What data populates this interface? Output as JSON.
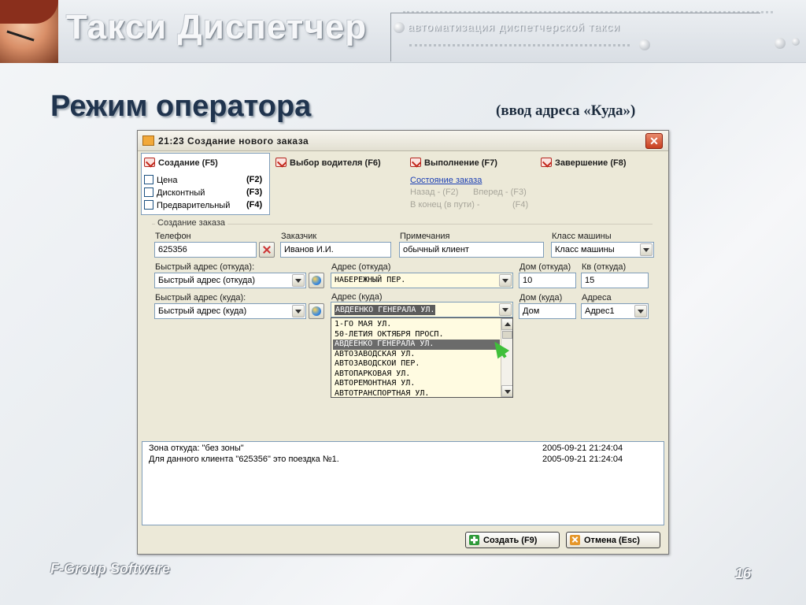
{
  "slide": {
    "app_title": "Такси Диспетчер",
    "tagline": "автоматизация диспетчерской такси",
    "title": "Режим оператора",
    "subtitle": "(ввод адреса «Куда»)",
    "footer_left": "F-Group Software",
    "page_number": "16"
  },
  "window": {
    "title": "21:23 Создание нового заказа",
    "close_label": "✕",
    "steps": [
      {
        "label": "Создание (F5)"
      },
      {
        "label": "Выбор водителя (F6)"
      },
      {
        "label": "Выполнение (F7)"
      },
      {
        "label": "Завершение (F8)"
      }
    ],
    "options": [
      {
        "label": "Цена",
        "key": "(F2)",
        "checked": false
      },
      {
        "label": "Дисконтный",
        "key": "(F3)",
        "checked": false
      },
      {
        "label": "Предварительный",
        "key": "(F4)",
        "checked": false
      }
    ],
    "order_state_link": "Состояние заказа",
    "nav": {
      "back": "Назад - (F2)",
      "forward": "Вперед - (F3)",
      "to_end": "В конец (в пути) -",
      "to_end_key": "(F4)"
    },
    "group_label": "Создание заказа",
    "form": {
      "phone_label": "Телефон",
      "phone_value": "625356",
      "customer_label": "Заказчик",
      "customer_value": "Иванов И.И.",
      "notes_label": "Примечания",
      "notes_value": "обычный клиент",
      "car_class_label": "Класс машины",
      "car_class_value": "Класс машины",
      "quick_from_label": "Быстрый адрес (откуда):",
      "quick_from_value": "Быстрый адрес (откуда)",
      "addr_from_label": "Адрес (откуда)",
      "addr_from_value": "НАБЕРЕЖНЫЙ ПЕР.",
      "house_from_label": "Дом (откуда)",
      "house_from_value": "10",
      "apt_from_label": "Кв (откуда)",
      "apt_from_value": "15",
      "quick_to_label": "Быстрый адрес (куда):",
      "quick_to_value": "Быстрый адрес (куда)",
      "addr_to_label": "Адрес (куда)",
      "addr_to_value": "АВДЕЕНКО ГЕНЕРАЛА УЛ.",
      "house_to_label": "Дом (куда)",
      "house_to_value": "Дом",
      "addresses_label": "Адреса",
      "addresses_value": "Адрес1"
    },
    "street_list": [
      "1-ГО МАЯ УЛ.",
      "50-ЛЕТИЯ ОКТЯБРЯ ПРОСП.",
      "АВДЕЕНКО ГЕНЕРАЛА УЛ.",
      "АВТОЗАВОДСКАЯ УЛ.",
      "АВТОЗАВОДСКОЙ ПЕР.",
      "АВТОПАРКОВАЯ УЛ.",
      "АВТОРЕМОНТНАЯ УЛ.",
      "АВТОТРАНСПОРТНАЯ УЛ."
    ],
    "street_list_selected_index": 2,
    "log": [
      {
        "text": "Зона откуда: \"без зоны\"",
        "time": "2005-09-21 21:24:04"
      },
      {
        "text": "Для данного клиента \"625356\" это поездка №1.",
        "time": "2005-09-21 21:24:04"
      }
    ],
    "buttons": {
      "create": "Создать (F9)",
      "cancel": "Отмена (Esc)"
    }
  },
  "colors": {
    "title_text": "#20344e",
    "window_bg": "#ece9d8",
    "link": "#1b3fb4",
    "highlight": "#6b6b6b",
    "address_field_bg": "#fffbe1"
  }
}
